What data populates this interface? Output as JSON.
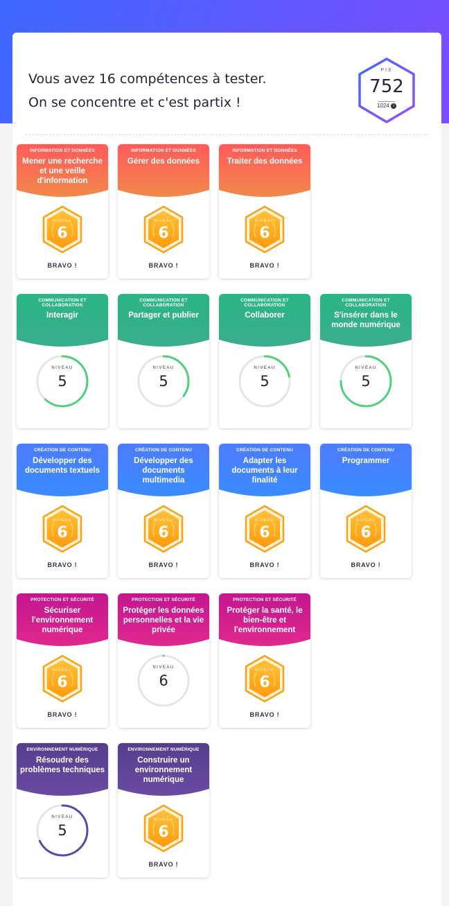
{
  "header": {
    "line1": "Vous avez 16 compétences à tester.",
    "line2": "On se concentre et c'est partix !"
  },
  "pix": {
    "label": "PIX",
    "score": "752",
    "max": "1024",
    "info_icon": "i"
  },
  "colors": {
    "information": [
      "#ff5b5b",
      "#f2884a"
    ],
    "communication": [
      "#2bb584",
      "#3aad8f"
    ],
    "creation": [
      "#4d7cff",
      "#3a8bff"
    ],
    "protection": [
      "#c3168f",
      "#e0288f"
    ],
    "environnement": [
      "#563e8c",
      "#6a4ba3"
    ],
    "ring_green": "#4fd07a",
    "ring_purple": "#5a4aa8",
    "hex_orange": "#ffab14"
  },
  "niveau_label": "NIVEAU",
  "bravo_label": "BRAVO !",
  "rows": [
    {
      "cards": [
        {
          "area": "INFORMATION ET DONNÉES",
          "name": "Mener une recherche et une veille d'information",
          "color": "information",
          "type": "hex",
          "level": "6",
          "bravo": true
        },
        {
          "area": "INFORMATION ET DONNÉES",
          "name": "Gérer des données",
          "color": "information",
          "type": "hex",
          "level": "6",
          "bravo": true
        },
        {
          "area": "INFORMATION ET DONNÉES",
          "name": "Traiter des données",
          "color": "information",
          "type": "hex",
          "level": "6",
          "bravo": true
        }
      ]
    },
    {
      "cards": [
        {
          "area": "COMMUNICATION ET COLLABORATION",
          "name": "Interagir",
          "color": "communication",
          "type": "ring",
          "level": "5",
          "progress": 0.62,
          "ring": "ring_green"
        },
        {
          "area": "COMMUNICATION ET COLLABORATION",
          "name": "Partager et publier",
          "color": "communication",
          "type": "ring",
          "level": "5",
          "progress": 0.35,
          "ring": "ring_green"
        },
        {
          "area": "COMMUNICATION ET COLLABORATION",
          "name": "Collaborer",
          "color": "communication",
          "type": "ring",
          "level": "5",
          "progress": 0.22,
          "ring": "ring_green"
        },
        {
          "area": "COMMUNICATION ET COLLABORATION",
          "name": "S'insérer dans le monde numérique",
          "color": "communication",
          "type": "ring",
          "level": "5",
          "progress": 0.75,
          "ring": "ring_green"
        }
      ]
    },
    {
      "cards": [
        {
          "area": "CRÉATION DE CONTENU",
          "name": "Développer des documents textuels",
          "color": "creation",
          "type": "hex",
          "level": "6",
          "bravo": true
        },
        {
          "area": "CRÉATION DE CONTENU",
          "name": "Développer des documents multimedia",
          "color": "creation",
          "type": "hex",
          "level": "6",
          "bravo": true
        },
        {
          "area": "CRÉATION DE CONTENU",
          "name": "Adapter les documents à leur finalité",
          "color": "creation",
          "type": "hex",
          "level": "6",
          "bravo": true
        },
        {
          "area": "CRÉATION DE CONTENU",
          "name": "Programmer",
          "color": "creation",
          "type": "hex",
          "level": "6",
          "bravo": true
        }
      ]
    },
    {
      "cards": [
        {
          "area": "PROTECTION ET SÉCURITÉ",
          "name": "Sécuriser l'environnement numérique",
          "color": "protection",
          "type": "hex",
          "level": "6",
          "bravo": true
        },
        {
          "area": "PROTECTION ET SÉCURITÉ",
          "name": "Protéger les données personnelles et la vie privée",
          "color": "protection",
          "type": "ring",
          "level": "6",
          "progress": 0.0,
          "ring": "ring_green"
        },
        {
          "area": "PROTECTION ET SÉCURITÉ",
          "name": "Protéger la santé, le bien-être et l'environnement",
          "color": "protection",
          "type": "hex",
          "level": "6",
          "bravo": true
        }
      ]
    },
    {
      "cards": [
        {
          "area": "ENVIRONNEMENT NUMÉRIQUE",
          "name": "Résoudre des problèmes techniques",
          "color": "environnement",
          "type": "ring",
          "level": "5",
          "progress": 0.68,
          "ring": "ring_purple"
        },
        {
          "area": "ENVIRONNEMENT NUMÉRIQUE",
          "name": "Construire un environnement numérique",
          "color": "environnement",
          "type": "hex",
          "level": "6",
          "bravo": true
        }
      ]
    }
  ]
}
